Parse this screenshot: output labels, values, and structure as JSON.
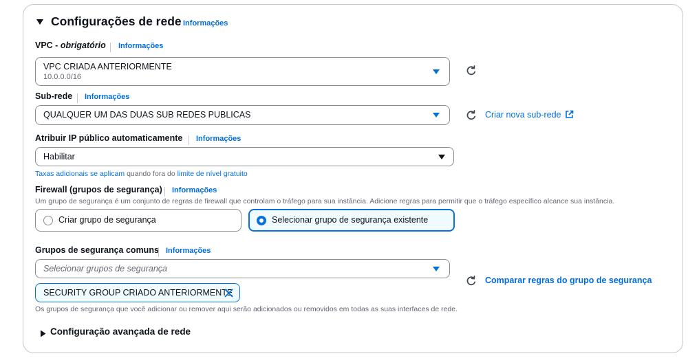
{
  "section": {
    "title": "Configurações de rede",
    "info": "Informações"
  },
  "vpc": {
    "label": "VPC - ",
    "label_required": "obrigatório",
    "info": "Informações",
    "value": "VPC CRIADA ANTERIORMENTE",
    "cidr": "10.0.0.0/16"
  },
  "subnet": {
    "label": "Sub-rede",
    "info": "Informações",
    "value": "QUALQUER UM DAS DUAS SUB REDES PUBLICAS",
    "create_link": "Criar nova sub-rede"
  },
  "public_ip": {
    "label": "Atribuir IP público automaticamente",
    "info": "Informações",
    "value": "Habilitar",
    "note_link1": "Taxas adicionais se aplicam",
    "note_mid": " quando fora do ",
    "note_link2": "limite de nível gratuito"
  },
  "firewall": {
    "label": "Firewall (grupos de segurança)",
    "info": "Informações",
    "description": "Um grupo de segurança é um conjunto de regras de firewall que controlam o tráfego para sua instância. Adicione regras para permitir que o tráfego específico alcance sua instância.",
    "option_create": "Criar grupo de segurança",
    "option_select": "Selecionar grupo de segurança existente",
    "selected": "select"
  },
  "common_groups": {
    "label": "Grupos de segurança comuns",
    "info": "Informações",
    "placeholder": "Selecionar grupos de segurança",
    "token": "SECURITY GROUP CRIADO ANTERIORMENTE",
    "compare_link": "Comparar regras do grupo de segurança",
    "note": "Os grupos de segurança que você adicionar ou remover aqui serão adicionados ou removidos em todas as suas interfaces de rede."
  },
  "advanced": {
    "title": "Configuração avançada de rede"
  },
  "colors": {
    "link": "#006ce0",
    "accent": "#0a6fd6",
    "selected_bg": "#f0fbff",
    "border": "#8c8c94"
  }
}
